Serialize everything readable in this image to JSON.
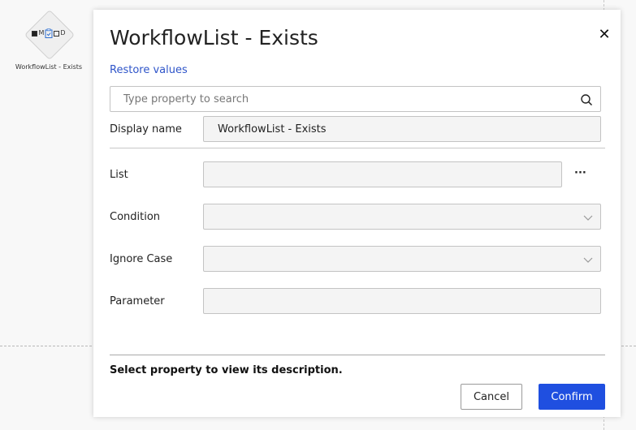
{
  "canvas": {
    "node_label": "WorkflowList - Exists",
    "node_glyph_m": "M",
    "node_glyph_d": "D"
  },
  "dialog": {
    "title": "WorkflowList - Exists",
    "restore_label": "Restore values",
    "search": {
      "placeholder": "Type property to search",
      "value": ""
    },
    "display_name": {
      "label": "Display name",
      "value": "WorkflowList - Exists"
    },
    "properties": {
      "list": {
        "label": "List",
        "value": "",
        "more_label": "···"
      },
      "condition": {
        "label": "Condition",
        "value": ""
      },
      "ignore_case": {
        "label": "Ignore Case",
        "value": ""
      },
      "parameter": {
        "label": "Parameter",
        "value": ""
      }
    },
    "description": "Select property to view its description.",
    "buttons": {
      "cancel": "Cancel",
      "confirm": "Confirm"
    }
  },
  "colors": {
    "accent": "#1f4fe0",
    "link": "#2f55c9"
  },
  "icons": [
    "close-icon",
    "search-icon",
    "chevron-down-icon",
    "clipboard-check-icon"
  ]
}
